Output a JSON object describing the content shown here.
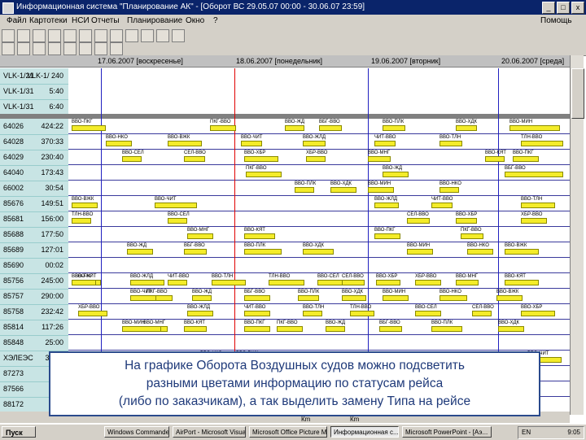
{
  "window": {
    "title": "Информационная система \"Планирование АК\" - [Оборот ВС 29.05.07 00:00 - 30.06.07 23:59]",
    "buttons": [
      "_",
      "□",
      "x"
    ]
  },
  "menu": {
    "items": [
      "Файл",
      "Картотеки",
      "НСИ",
      "Отчеты",
      "Планирование",
      "Окно",
      "?"
    ],
    "right_label": "Помощь"
  },
  "timeline": {
    "dates": [
      "17.06.2007 [воскресенье]",
      "18.06.2007 [понедельник]",
      "19.06.2007 [вторник]",
      "20.06.2007 [среда]"
    ]
  },
  "upper_rows": [
    {
      "id": "VLK-1/21",
      "value": "VLK-1/ 240"
    },
    {
      "id": "VLK-1/31",
      "value": "5:40"
    },
    {
      "id": "VLK-1/31",
      "value": "6:40"
    }
  ],
  "rows": [
    {
      "id": "64026",
      "value": "424:22"
    },
    {
      "id": "64028",
      "value": "370:33"
    },
    {
      "id": "64029",
      "value": "230:40"
    },
    {
      "id": "64040",
      "value": "173:43"
    },
    {
      "id": "66002",
      "value": "30:54"
    },
    {
      "id": "85676",
      "value": "149:51"
    },
    {
      "id": "85681",
      "value": "156:00"
    },
    {
      "id": "85688",
      "value": "177:50"
    },
    {
      "id": "85689",
      "value": "127:01"
    },
    {
      "id": "85690",
      "value": "00:02"
    },
    {
      "id": "85756",
      "value": "245:00"
    },
    {
      "id": "85757",
      "value": "290:00"
    },
    {
      "id": "85758",
      "value": "232:42"
    },
    {
      "id": "85814",
      "value": "117:26"
    },
    {
      "id": "85848",
      "value": "25:00"
    },
    {
      "id": "ХЭЛЕЭС",
      "value": "32:00"
    },
    {
      "id": "87273",
      "value": ""
    },
    {
      "id": "87566",
      "value": ""
    },
    {
      "id": "88172",
      "value": ""
    }
  ],
  "flight_labels": [
    "ВВО-ПКГ",
    "ПКГ-ВВО",
    "ВВО-ЖД",
    "ВБГ-ВВО",
    "ВВО-ПЛК",
    "ВВО-ХДК",
    "ВВО-МИН",
    "ВВО-НКО",
    "ВВО-ВЖК",
    "ВВО-ЧИТ",
    "ВВО-ЖЛД",
    "ЧИТ-ВВО",
    "ВВО-ТЛН",
    "ТЛН-ВВО",
    "ВВО-СЕЛ",
    "СЕЛ-ВВО",
    "ВВО-ХБР",
    "ХБР-ВВО",
    "ВВО-МНГ",
    "ВВО-КЯТ"
  ],
  "status": {
    "km_labels": [
      "Кm",
      "Кm"
    ]
  },
  "taskbar": {
    "start": "Пуск",
    "tasks": [
      "Windows Commander 3.5...",
      "AirPort - Microsoft Visual ...",
      "Microsoft Office Picture M...",
      "Информационная с...",
      "Microsoft PowerPoint - [Аэ..."
    ],
    "active_index": 3,
    "lang": "EN",
    "clock": "9:05"
  },
  "overlay": {
    "lines": [
      "На графике Оборота Воздушных судов можно подсветить",
      "разными цветами информацию по статусам рейса",
      "(либо по заказчикам), а так выделить замену Типа на рейсе"
    ]
  },
  "colors": {
    "titlebar": "#0a246a",
    "bar": "#f4ec2a",
    "left_column": "#c8e4e4",
    "current_time_line": "#e00000",
    "day_line": "#2020c0",
    "overlay_text": "#1f3a7a"
  }
}
